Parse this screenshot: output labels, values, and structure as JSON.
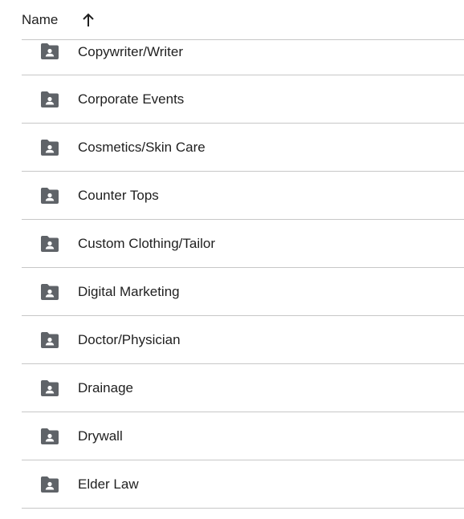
{
  "header": {
    "name_label": "Name",
    "sort_icon": "arrow-up-icon"
  },
  "folders": [
    {
      "label": "Copywriter/Writer",
      "icon": "shared-folder-icon"
    },
    {
      "label": "Corporate Events",
      "icon": "shared-folder-icon"
    },
    {
      "label": "Cosmetics/Skin Care",
      "icon": "shared-folder-icon"
    },
    {
      "label": "Counter Tops",
      "icon": "shared-folder-icon"
    },
    {
      "label": "Custom Clothing/Tailor",
      "icon": "shared-folder-icon"
    },
    {
      "label": "Digital Marketing",
      "icon": "shared-folder-icon"
    },
    {
      "label": "Doctor/Physician",
      "icon": "shared-folder-icon"
    },
    {
      "label": "Drainage",
      "icon": "shared-folder-icon"
    },
    {
      "label": "Drywall",
      "icon": "shared-folder-icon"
    },
    {
      "label": "Elder Law",
      "icon": "shared-folder-icon"
    }
  ],
  "colors": {
    "icon": "#5f6368",
    "text": "#1f1f1f",
    "divider": "#c7c7c7"
  }
}
